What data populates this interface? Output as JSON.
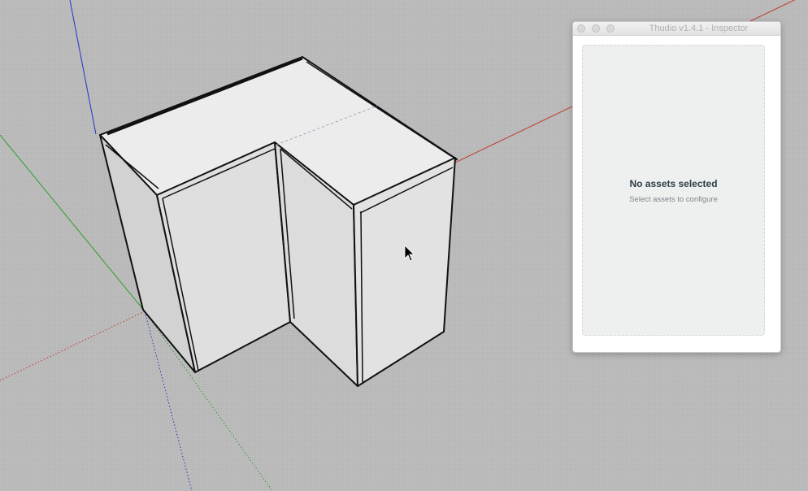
{
  "inspector": {
    "title": "Thudio v1.4.1 - Inspector",
    "empty_title": "No assets selected",
    "empty_subtitle": "Select assets to configure"
  },
  "icons": {
    "close": "close-icon",
    "minimize": "minimize-icon",
    "maximize": "maximize-icon",
    "cursor": "mouse-pointer-icon"
  },
  "colors": {
    "background": "#b9b9b9",
    "axis_red": "#c0392b",
    "axis_green": "#2e9e2e",
    "axis_blue": "#2233cc",
    "model_face": "#e6e6e6"
  }
}
